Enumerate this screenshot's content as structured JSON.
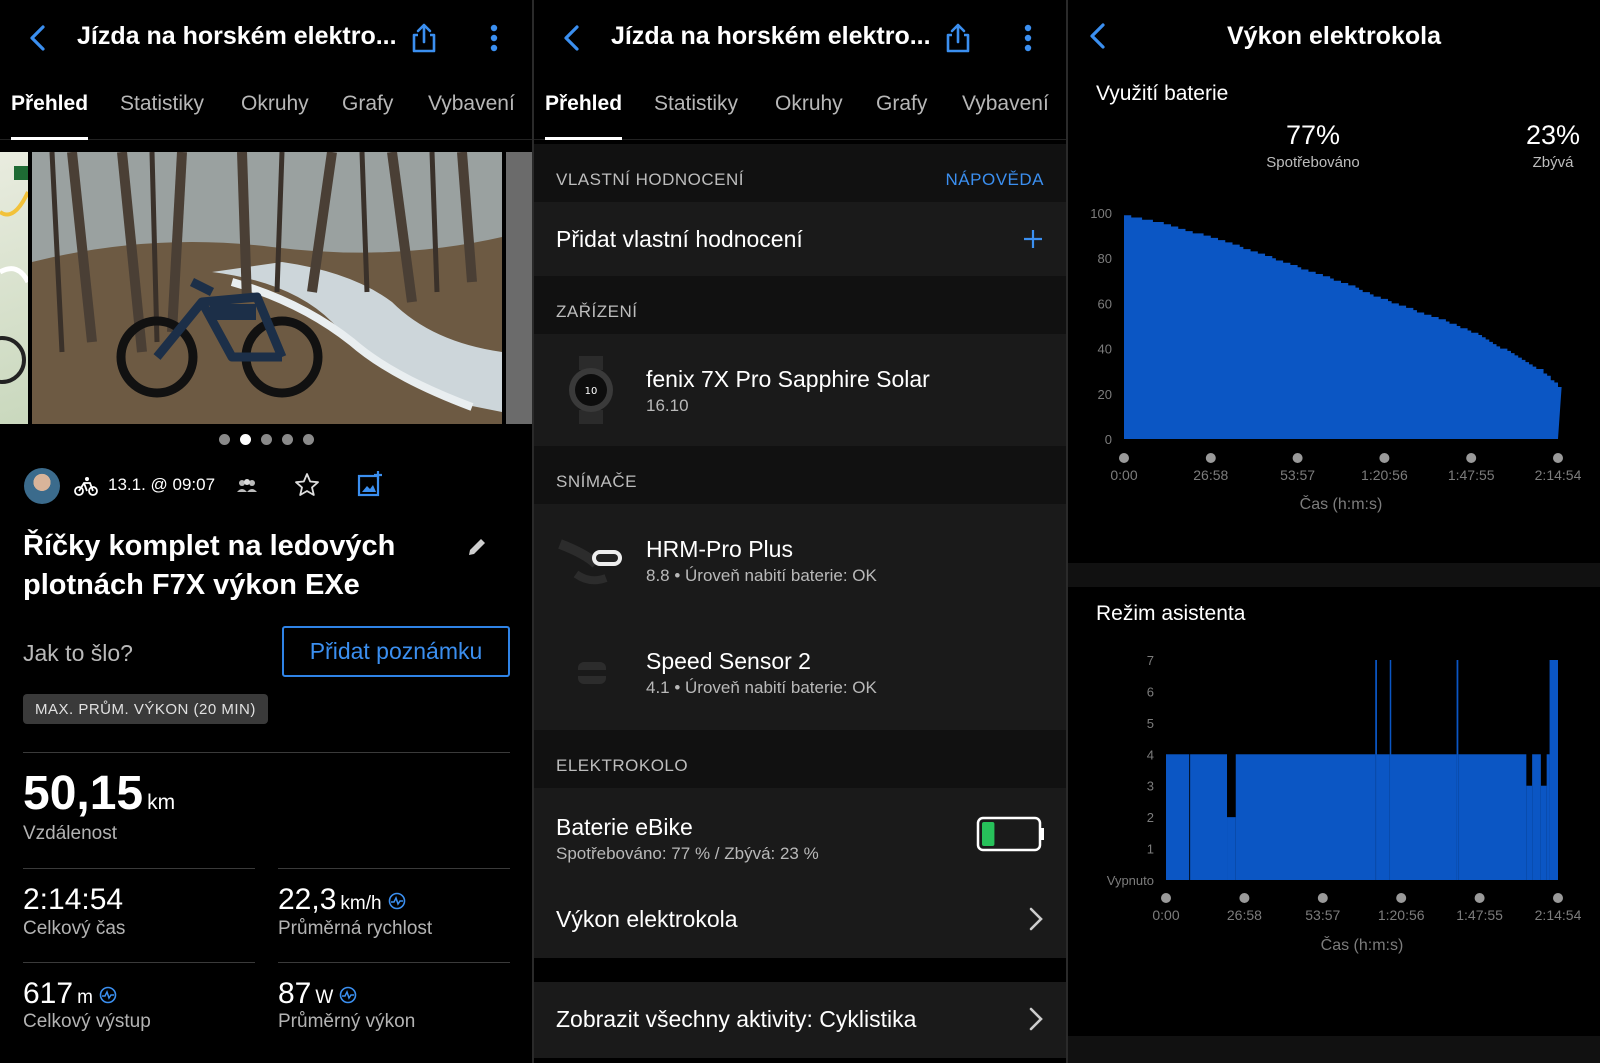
{
  "panel1": {
    "header": {
      "title": "Jízda na horském elektro..."
    },
    "tabs": [
      "Přehled",
      "Statistiky",
      "Okruhy",
      "Grafy",
      "Vybavení"
    ],
    "meta": {
      "date": "13.1. @ 09:07"
    },
    "activity_title_line1": "Říčky komplet na ledových",
    "activity_title_line2": "plotnách F7X výkon EXe",
    "how_label": "Jak to šlo?",
    "note_button": "Přidat poznámku",
    "badge": "MAX. PRŮM. VÝKON (20 MIN)",
    "distance": {
      "value": "50,15",
      "unit": "km",
      "label": "Vzdálenost"
    },
    "time": {
      "value": "2:14:54",
      "label": "Celkový čas"
    },
    "speed": {
      "value": "22,3",
      "unit": "km/h",
      "label": "Průměrná rychlost"
    },
    "ascent": {
      "value": "617",
      "unit": "m",
      "label": "Celkový výstup"
    },
    "power": {
      "value": "87",
      "unit": "W",
      "label": "Průměrný výkon"
    },
    "photo_dots": 5,
    "photo_active": 1
  },
  "panel2": {
    "header": {
      "title": "Jízda na horském elektro..."
    },
    "tabs": [
      "Přehled",
      "Statistiky",
      "Okruhy",
      "Grafy",
      "Vybavení"
    ],
    "rating_section": "VLASTNÍ HODNOCENÍ",
    "help": "NÁPOVĚDA",
    "add_rating": "Přidat vlastní hodnocení",
    "device_section": "ZAŘÍZENÍ",
    "device": {
      "name": "fenix 7X Pro Sapphire Solar",
      "version": "16.10"
    },
    "sensors_section": "SNÍMAČE",
    "sensors": [
      {
        "name": "HRM-Pro Plus",
        "detail": "8.8 • Úroveň nabití baterie: OK"
      },
      {
        "name": "Speed Sensor 2",
        "detail": "4.1 • Úroveň nabití baterie: OK"
      }
    ],
    "ebike_section": "ELEKTROKOLO",
    "battery": {
      "name": "Baterie eBike",
      "detail": "Spotřebováno: 77 % / Zbývá: 23 %",
      "remaining_fraction": 0.23
    },
    "ebike_power": "Výkon elektrokola",
    "all_activities": "Zobrazit všechny aktivity: Cyklistika"
  },
  "panel3": {
    "header": {
      "title": "Výkon elektrokola"
    },
    "battery_title": "Využití baterie",
    "consumed": {
      "value": "77%",
      "label": "Spotřebováno"
    },
    "remaining": {
      "value": "23%",
      "label": "Zbývá"
    },
    "assist_title": "Režim asistenta",
    "x_axis_label": "Čas (h:m:s)",
    "x_ticks": [
      "0:00",
      "26:58",
      "53:57",
      "1:20:56",
      "1:47:55",
      "2:14:54"
    ],
    "battery_y_ticks": [
      "100",
      "80",
      "60",
      "40",
      "20",
      "0"
    ],
    "assist_y_ticks": [
      "7",
      "6",
      "5",
      "4",
      "3",
      "2",
      "1",
      "Vypnuto"
    ]
  },
  "chart_data": [
    {
      "type": "area",
      "title": "Využití baterie",
      "xlabel": "Čas (h:m:s)",
      "ylabel": "",
      "x_unit": "minutes",
      "x": [
        0,
        10,
        20,
        30,
        40,
        50,
        60,
        70,
        80,
        90,
        100,
        110,
        120,
        130,
        134.9
      ],
      "y": [
        99,
        96,
        92,
        88,
        83,
        78,
        73,
        68,
        62,
        57,
        52,
        46,
        38,
        30,
        23
      ],
      "ylim": [
        0,
        100
      ],
      "color": "#0b56c4"
    },
    {
      "type": "area",
      "title": "Režim asistenta",
      "xlabel": "Čas (h:m:s)",
      "ylabel": "",
      "x_unit": "minutes",
      "segments": [
        {
          "from": 0,
          "to": 8,
          "value": 4
        },
        {
          "from": 8,
          "to": 8.3,
          "value": 0
        },
        {
          "from": 8.3,
          "to": 21,
          "value": 4
        },
        {
          "from": 21,
          "to": 24,
          "value": 2
        },
        {
          "from": 24,
          "to": 72,
          "value": 4
        },
        {
          "from": 72,
          "to": 72.6,
          "value": 7
        },
        {
          "from": 72.6,
          "to": 77,
          "value": 4
        },
        {
          "from": 77,
          "to": 77.4,
          "value": 7
        },
        {
          "from": 77.4,
          "to": 100,
          "value": 4
        },
        {
          "from": 100,
          "to": 100.6,
          "value": 7
        },
        {
          "from": 100.6,
          "to": 124,
          "value": 4
        },
        {
          "from": 124,
          "to": 126,
          "value": 3
        },
        {
          "from": 126,
          "to": 129,
          "value": 4
        },
        {
          "from": 129,
          "to": 131,
          "value": 3
        },
        {
          "from": 131,
          "to": 132,
          "value": 4
        },
        {
          "from": 132,
          "to": 134.9,
          "value": 7
        }
      ],
      "ylim": [
        0,
        7
      ],
      "color": "#0b56c4"
    }
  ]
}
